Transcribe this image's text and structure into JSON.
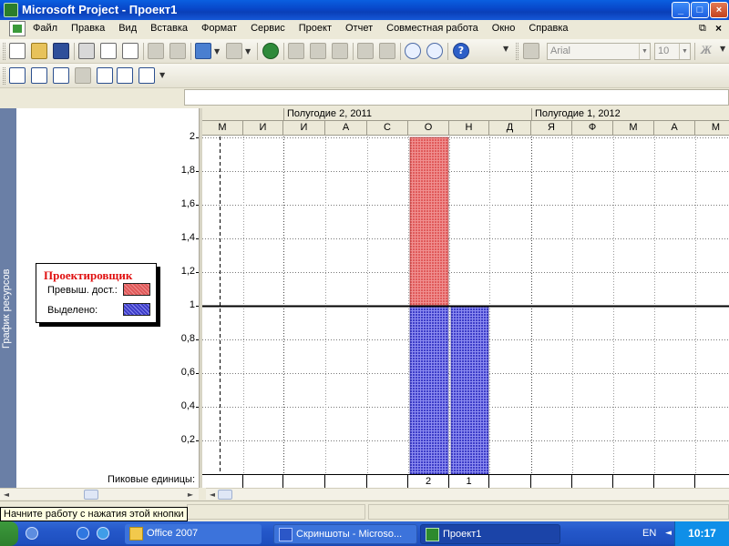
{
  "window": {
    "title": "Microsoft Project - Проект1"
  },
  "menu": {
    "items": [
      "Файл",
      "Правка",
      "Вид",
      "Вставка",
      "Формат",
      "Сервис",
      "Проект",
      "Отчет",
      "Совместная работа",
      "Окно",
      "Справка"
    ]
  },
  "toolbar": {
    "font": "Arial",
    "font_size": "10",
    "bold_icon_text": "Ж",
    "help_icon_text": "?"
  },
  "view_bar": {
    "label": "График ресурсов"
  },
  "legend": {
    "title": "Проектировщик",
    "over_label": "Превыш. дост.:",
    "alloc_label": "Выделено:",
    "over_color": "#e05a5a",
    "alloc_color": "#3d3dc8"
  },
  "peak_units": {
    "label": "Пиковые единицы:"
  },
  "timescale": {
    "periods": [
      "Полугодие 2, 2011",
      "Полугодие 1, 2012"
    ],
    "months": [
      "М",
      "И",
      "И",
      "А",
      "С",
      "О",
      "Н",
      "Д",
      "Я",
      "Ф",
      "М",
      "А",
      "М"
    ]
  },
  "chart_data": {
    "type": "bar",
    "title": "",
    "xlabel": "",
    "ylabel": "",
    "categories": [
      "М",
      "И",
      "И",
      "А",
      "С",
      "О",
      "Н",
      "Д",
      "Я",
      "Ф",
      "М",
      "А",
      "М"
    ],
    "ylim": [
      0,
      2
    ],
    "yticks": [
      0.2,
      0.4,
      0.6,
      0.8,
      1,
      1.2,
      1.4,
      1.6,
      1.8,
      2
    ],
    "ytick_labels": [
      "0,2",
      "0,4",
      "0,6",
      "0,8",
      "1",
      "1,2",
      "1,4",
      "1,6",
      "1,8",
      "2"
    ],
    "max_units_line": 1,
    "series": [
      {
        "name": "Выделено:",
        "color": "#3d3dc8",
        "values": [
          0,
          0,
          0,
          0,
          0,
          1,
          1,
          0,
          0,
          0,
          0,
          0,
          0
        ]
      },
      {
        "name": "Превыш. дост.:",
        "color": "#e05a5a",
        "values": [
          0,
          0,
          0,
          0,
          0,
          1,
          0,
          0,
          0,
          0,
          0,
          0,
          0
        ]
      }
    ],
    "peak_units": [
      "",
      "",
      "",
      "",
      "",
      "2",
      "1",
      "",
      "",
      "",
      "",
      "",
      ""
    ]
  },
  "status": {
    "tooltip": "Начните работу с нажатия этой кнопки"
  },
  "taskbar": {
    "buttons": [
      "Office 2007",
      "Скриншоты - Microso...",
      "Проект1"
    ],
    "lang": "EN",
    "clock": "10:17"
  }
}
